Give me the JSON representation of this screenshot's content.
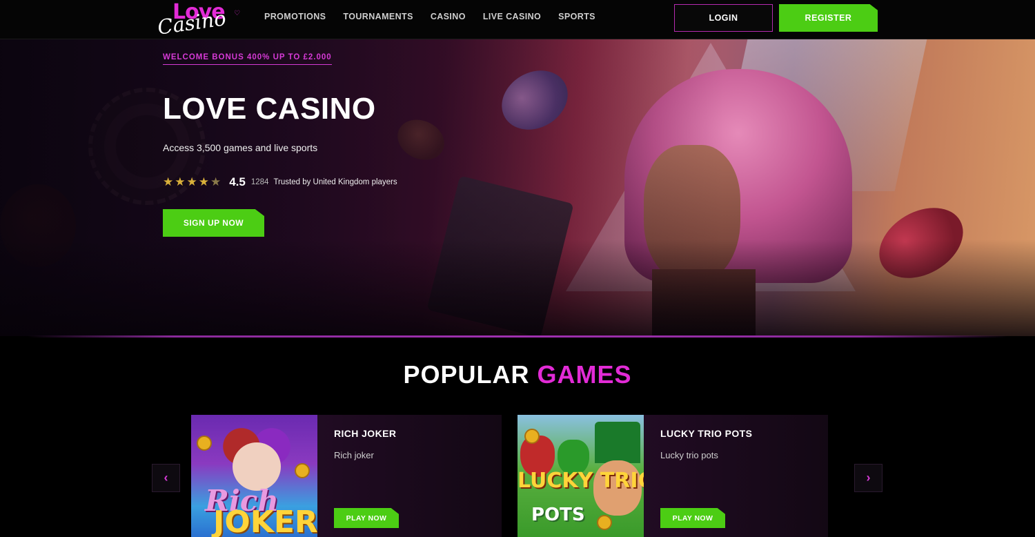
{
  "brand": {
    "logo_top": "Love",
    "logo_bottom": "Casino",
    "accent": "#e22bd6",
    "cta_green": "#4ccd14"
  },
  "nav": {
    "items": [
      "PROMOTIONS",
      "TOURNAMENTS",
      "CASINO",
      "LIVE CASINO",
      "SPORTS"
    ]
  },
  "auth": {
    "login_label": "LOGIN",
    "register_label": "REGISTER"
  },
  "hero": {
    "eyebrow": "WELCOME BONUS 400% UP TO £2.000",
    "title": "LOVE CASINO",
    "subtitle": "Access 3,500 games and live sports",
    "rating": {
      "stars_full": "★★★★",
      "stars_partial": "★",
      "score": "4.5",
      "count": "1284",
      "trust_text": "Trusted by United Kingdom players"
    },
    "cta_label": "SIGN UP NOW"
  },
  "popular": {
    "title_part1": "POPULAR",
    "title_part2": "GAMES",
    "prev_icon": "‹",
    "next_icon": "›",
    "games": [
      {
        "name": "RICH JOKER",
        "description": "Rich joker",
        "play_label": "PLAY NOW",
        "thumb_text_top": "Rich",
        "thumb_text_bottom": "JOKER"
      },
      {
        "name": "LUCKY TRIO POTS",
        "description": "Lucky trio pots",
        "play_label": "PLAY NOW",
        "thumb_text_top": "LUCKY TRIO",
        "thumb_text_bottom": "POTS"
      }
    ]
  }
}
